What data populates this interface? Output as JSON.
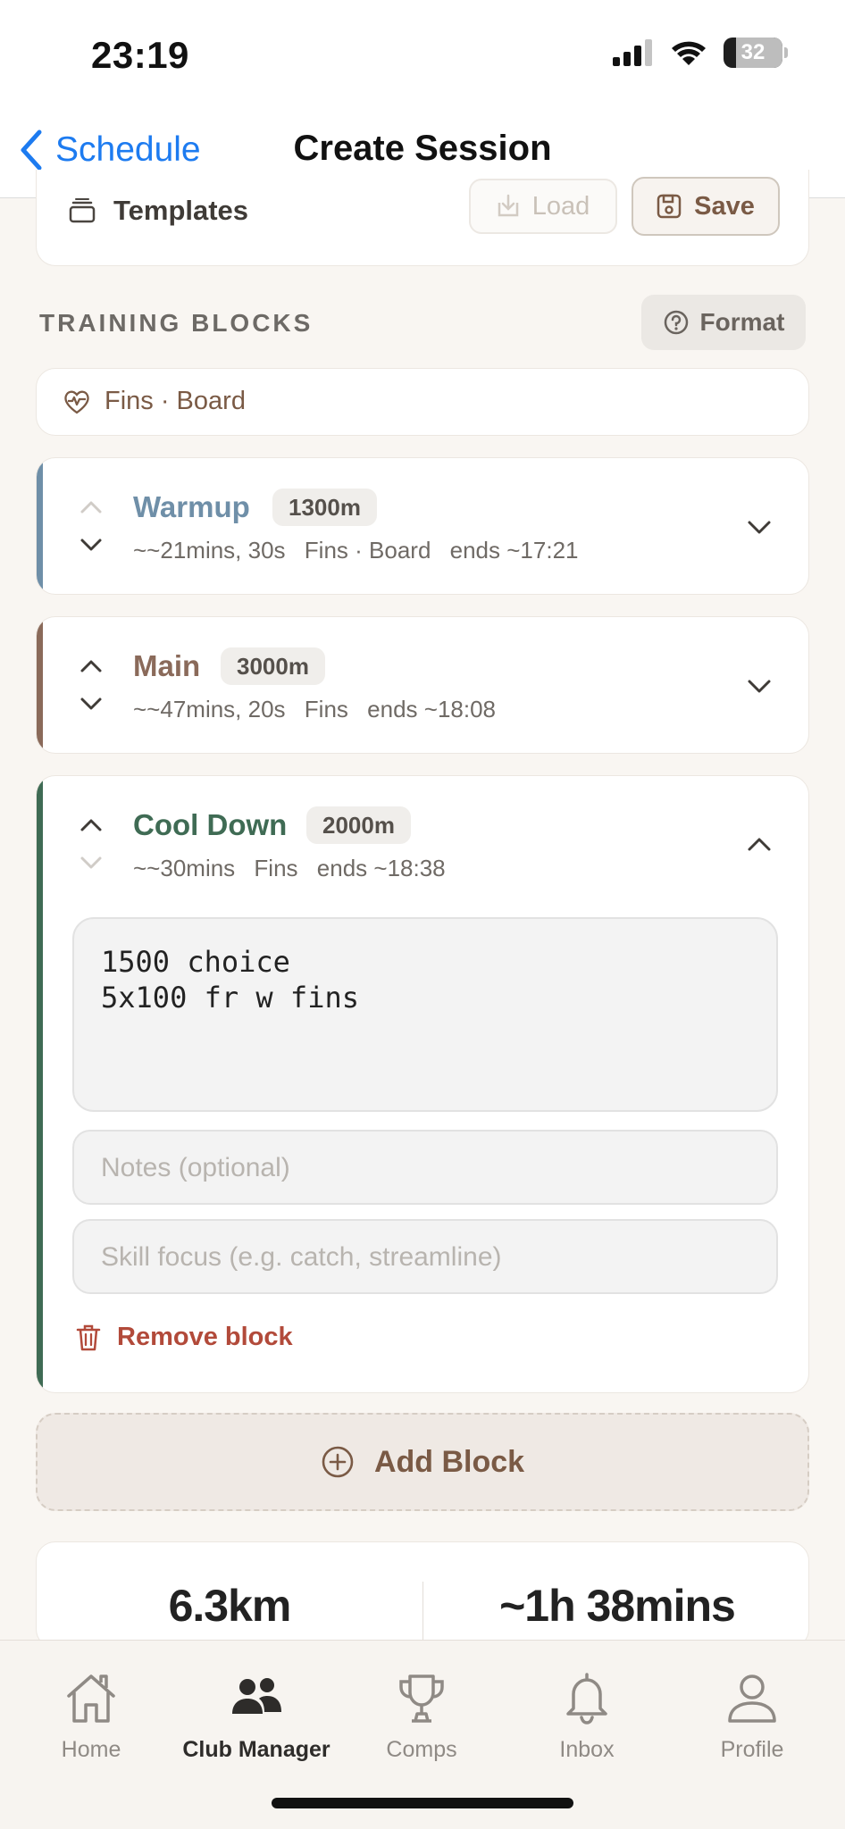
{
  "status_bar": {
    "time": "23:19",
    "battery": "32"
  },
  "nav": {
    "back_label": "Schedule",
    "title": "Create Session"
  },
  "templates": {
    "label": "Templates",
    "load_label": "Load",
    "save_label": "Save"
  },
  "training_blocks": {
    "header": "TRAINING BLOCKS",
    "format_label": "Format",
    "equipment_summary": "Fins · Board"
  },
  "blocks": [
    {
      "name": "Warmup",
      "distance": "1300m",
      "duration": "~~21mins, 30s",
      "equipment": "Fins · Board",
      "ends": "ends ~17:21",
      "color": "#6f8fa8"
    },
    {
      "name": "Main",
      "distance": "3000m",
      "duration": "~~47mins, 20s",
      "equipment": "Fins",
      "ends": "ends ~18:08",
      "color": "#8a6a5a"
    },
    {
      "name": "Cool Down",
      "distance": "2000m",
      "duration": "~~30mins",
      "equipment": "Fins",
      "ends": "ends ~18:38",
      "color": "#3f6b54",
      "workout_text": "1500 choice\n5x100 fr w fins",
      "notes_placeholder": "Notes (optional)",
      "skill_placeholder": "Skill focus (e.g. catch, streamline)",
      "remove_label": "Remove block"
    }
  ],
  "add_block_label": "Add Block",
  "summary": {
    "distance": "6.3km",
    "duration": "~1h 38mins"
  },
  "tabs": [
    {
      "label": "Home",
      "icon": "home-icon"
    },
    {
      "label": "Club Manager",
      "icon": "people-icon"
    },
    {
      "label": "Comps",
      "icon": "trophy-icon"
    },
    {
      "label": "Inbox",
      "icon": "bell-icon"
    },
    {
      "label": "Profile",
      "icon": "person-icon"
    }
  ]
}
